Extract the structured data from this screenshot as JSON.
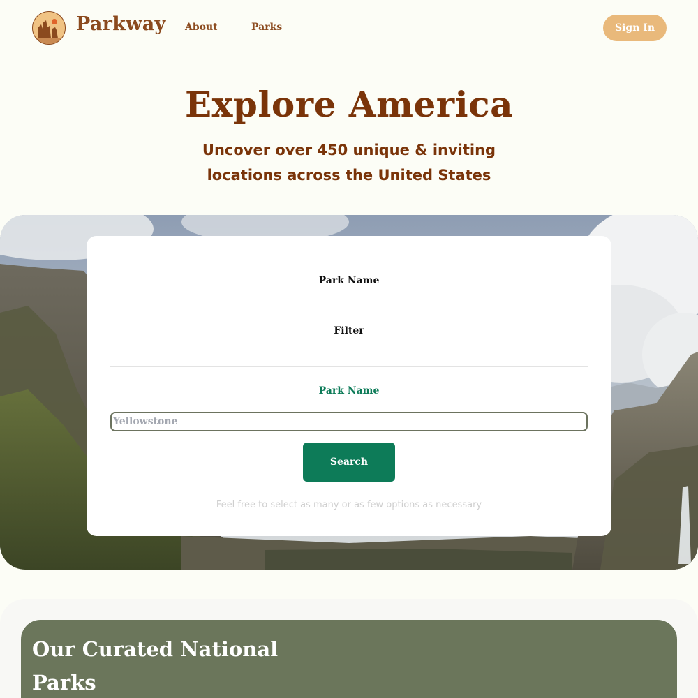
{
  "header": {
    "logo_icon": "rock-formation-icon",
    "brand": "Parkway",
    "nav": {
      "about": "About",
      "parks": "Parks"
    },
    "sign_in": "Sign In"
  },
  "hero": {
    "title": "Explore America",
    "subtitle": "Uncover over 450 unique & inviting locations across the United States"
  },
  "search_card": {
    "label_park_name": "Park Name",
    "label_filter": "Filter",
    "field_label": "Park Name",
    "input_value": "",
    "input_placeholder": "Yellowstone",
    "search_button": "Search",
    "hint": "Feel free to select as many or as few options as necessary"
  },
  "curated": {
    "title": "Our Curated National Parks"
  },
  "colors": {
    "background": "#fcfdf6",
    "brand_brown": "#8b4a1e",
    "heading_brown": "#7a3409",
    "sign_in_button": "#e9b97b",
    "primary_green": "#0d7b58",
    "curated_green": "#6b765b"
  }
}
